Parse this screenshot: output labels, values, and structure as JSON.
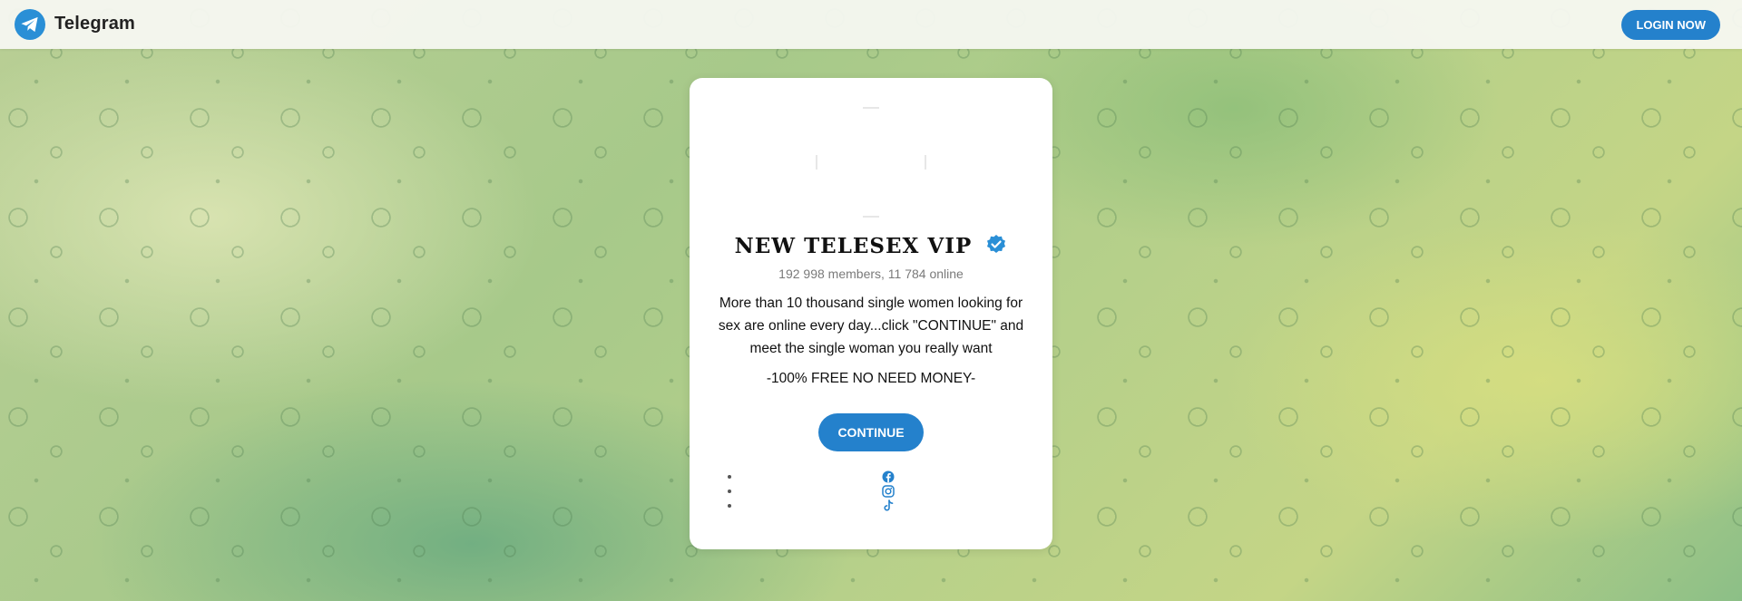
{
  "header": {
    "brand": "Telegram",
    "login_label": "LOGIN NOW"
  },
  "card": {
    "title": "NEW TELESEX VIP",
    "members": "192 998 members, 11 784 online",
    "description": "More than 10 thousand single women looking for sex are online every day...click \"CONTINUE\" and meet the single woman you really want",
    "free_text": "-100% FREE NO NEED MONEY-",
    "continue_label": "CONTINUE"
  },
  "social": [
    "facebook-icon",
    "instagram-icon",
    "tiktok-icon"
  ],
  "colors": {
    "accent": "#2481cc",
    "logo": "#2a8fd6",
    "verified": "#2a8fd6"
  }
}
